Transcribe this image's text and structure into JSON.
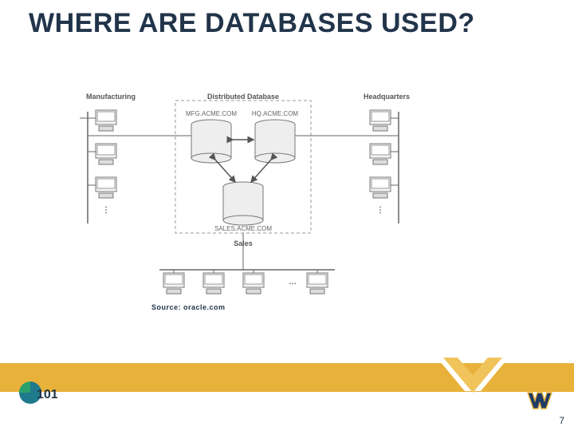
{
  "title": "WHERE ARE DATABASES USED?",
  "source": "Source: oracle.com",
  "page_number": "7",
  "diagram": {
    "col_left": "Manufacturing",
    "col_center": "Distributed Database",
    "col_right": "Headquarters",
    "col_bottom": "Sales",
    "db_left": "MFG.ACME.COM",
    "db_right": "HQ.ACME.COM",
    "db_bottom": "SALES.ACME.COM"
  }
}
